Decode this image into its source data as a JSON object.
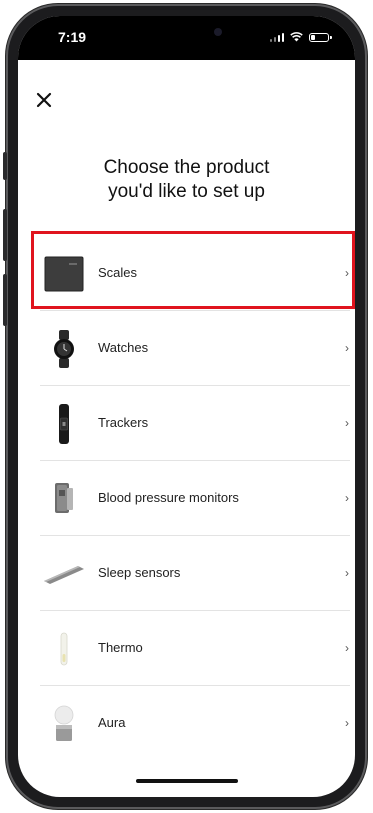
{
  "status_bar": {
    "time": "7:19"
  },
  "header": {
    "close_icon": "close-icon"
  },
  "title": "Choose the product\nyou'd like to set up",
  "products": [
    {
      "label": "Scales",
      "icon": "scale-icon",
      "selected": true
    },
    {
      "label": "Watches",
      "icon": "watch-icon"
    },
    {
      "label": "Trackers",
      "icon": "tracker-icon"
    },
    {
      "label": "Blood pressure monitors",
      "icon": "blood-pressure-monitor-icon"
    },
    {
      "label": "Sleep sensors",
      "icon": "sleep-sensor-icon"
    },
    {
      "label": "Thermo",
      "icon": "thermometer-icon"
    },
    {
      "label": "Aura",
      "icon": "aura-icon"
    }
  ],
  "chevron": "›",
  "colors": {
    "highlight": "#e0141e",
    "background": "#ffffff",
    "text": "#111111"
  }
}
